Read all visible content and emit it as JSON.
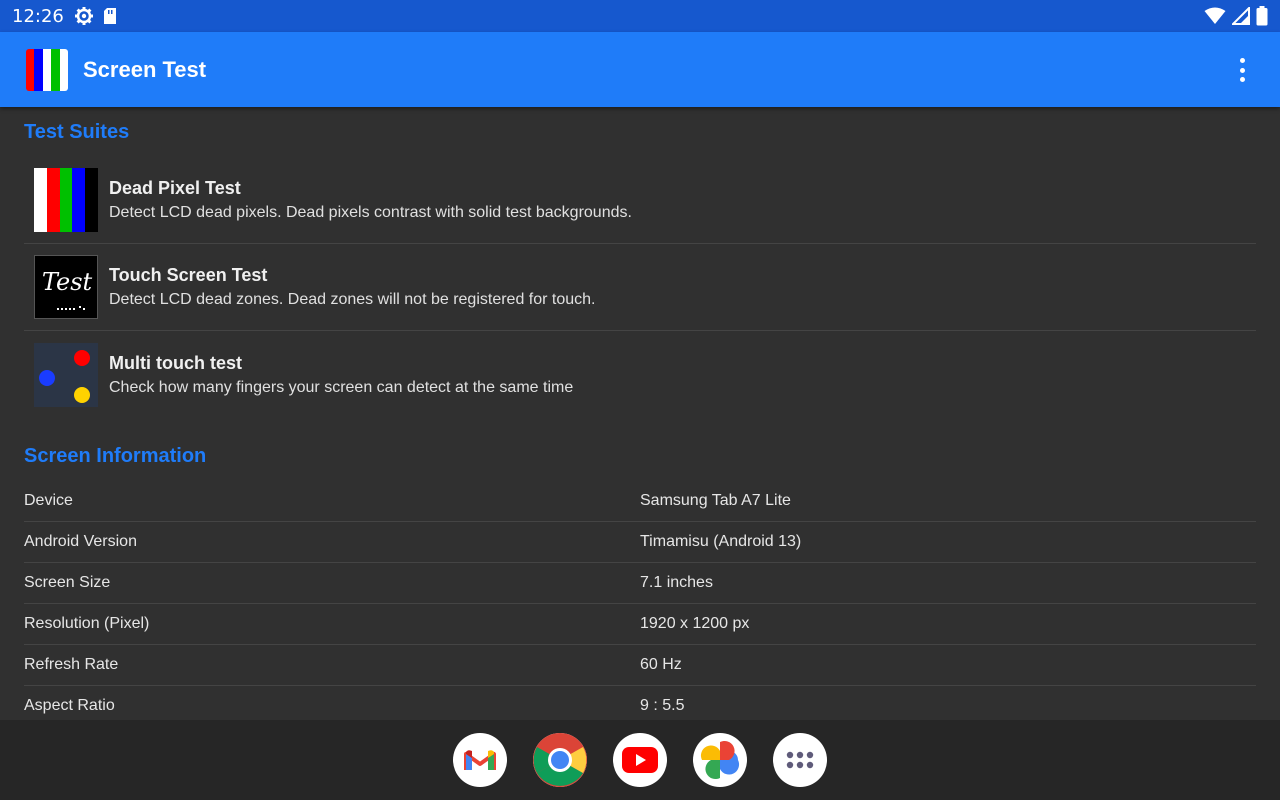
{
  "status_bar": {
    "time": "12:26",
    "icons": [
      "settings-gear-icon",
      "sd-card-icon",
      "wifi-icon",
      "signal-icon",
      "battery-icon"
    ]
  },
  "app_bar": {
    "title": "Screen Test",
    "logo_colors": [
      "#ff0000",
      "#0000ff",
      "#ffffff",
      "#00c000"
    ],
    "overflow_icon": "more-vert-icon",
    "color": "#1f7cf9"
  },
  "test_suites": {
    "title": "Test Suites",
    "items": [
      {
        "name": "Dead Pixel Test",
        "description": "Detect LCD dead pixels. Dead pixels contrast with solid test backgrounds.",
        "icon": "color-bars-icon"
      },
      {
        "name": "Touch Screen Test",
        "description": "Detect LCD dead zones. Dead zones will not be registered for touch.",
        "icon": "handwriting-test-icon",
        "thumb_text": "Test"
      },
      {
        "name": "Multi touch test",
        "description": "Check how many fingers your screen can detect at the same time",
        "icon": "colored-dots-icon"
      }
    ]
  },
  "screen_info": {
    "title": "Screen Information",
    "rows": [
      {
        "label": "Device",
        "value": "Samsung Tab A7 Lite"
      },
      {
        "label": "Android Version",
        "value": "Timamisu (Android 13)"
      },
      {
        "label": "Screen Size",
        "value": "7.1 inches"
      },
      {
        "label": "Resolution (Pixel)",
        "value": "1920 x 1200 px"
      },
      {
        "label": "Refresh Rate",
        "value": "60 Hz"
      },
      {
        "label": "Aspect Ratio",
        "value": "9 : 5.5"
      }
    ]
  },
  "dock": {
    "apps": [
      "gmail-icon",
      "chrome-icon",
      "youtube-icon",
      "photos-icon",
      "app-drawer-icon"
    ]
  }
}
